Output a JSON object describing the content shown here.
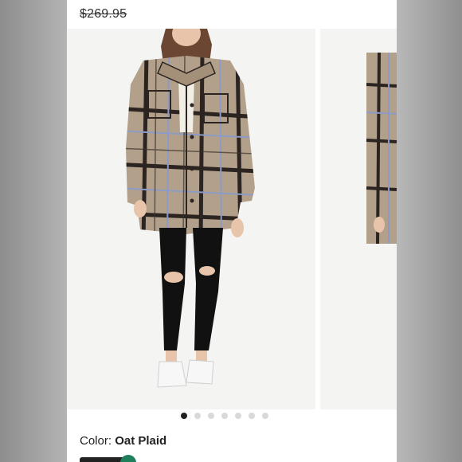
{
  "product": {
    "original_price": "$269.95"
  },
  "gallery": {
    "slide_count": 7,
    "active_index": 0
  },
  "color": {
    "label": "Color:",
    "value": "Oat Plaid"
  },
  "colors": {
    "coat_base": "#b3a08a",
    "plaid_dark": "#2b2420",
    "plaid_blue": "#8c9bc6",
    "active_dot": "#222222",
    "inactive_dot": "#d9d9d9",
    "badge_green": "#1e7f5a"
  }
}
